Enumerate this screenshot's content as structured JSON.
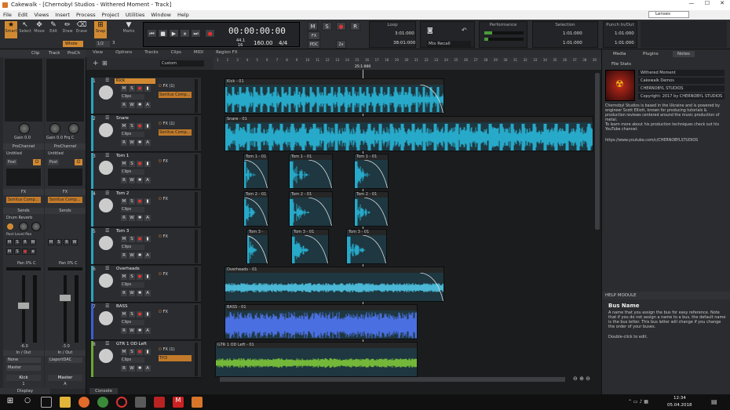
{
  "window": {
    "title": "Cakewalk - [Chernobyl Studios - Withered Moment - Track]",
    "app_icon": "cakewalk-icon"
  },
  "menu": [
    "File",
    "Edit",
    "Views",
    "Insert",
    "Process",
    "Project",
    "Utilities",
    "Window",
    "Help"
  ],
  "lenses": "Lenses",
  "tools": [
    {
      "label": "Smart",
      "icon": "star-icon"
    },
    {
      "label": "Select",
      "icon": "arrow-icon"
    },
    {
      "label": "Move",
      "icon": "move-icon"
    },
    {
      "label": "Edit",
      "icon": "pencil-edit-icon"
    },
    {
      "label": "Draw",
      "icon": "pencil-icon"
    },
    {
      "label": "Erase",
      "icon": "eraser-icon"
    }
  ],
  "snap": {
    "label": "Snap",
    "value": "1/2",
    "count": "3"
  },
  "marks": "Marks",
  "whole": "Whole",
  "transport": {
    "time": "00:00:00:00",
    "bars": "44.1",
    "bit": "16",
    "tempo": "160.00",
    "meter": "4/4"
  },
  "loop": {
    "label": "Loop",
    "start": "3:01:000",
    "end": "38:01:000"
  },
  "mix_recall": "Mix Recall",
  "performance": {
    "label": "Performance"
  },
  "selection": {
    "label": "Selection",
    "start": "1:01:000",
    "end": "1:01:000"
  },
  "punch": {
    "label": "Punch In/Out",
    "start": "1:01:000",
    "end": "1:01:000"
  },
  "mix_buttons": {
    "m": "M",
    "s": "S",
    "r": "R",
    "fx": "FX",
    "pdc": "PDC",
    "mode": "2x"
  },
  "inspector": {
    "tabs": [
      "Clip",
      "Track",
      "ProCh"
    ],
    "gain_label": "Gain",
    "gain_val": "0.0",
    "freq": "Frq",
    "freq_val": "C",
    "prochannel": "ProChannel",
    "untitled": "Untitled",
    "post": "Post",
    "fx": "FX",
    "fx_slot": "Sonitus Comp...",
    "sends": "Sends",
    "send_name": "Drum Reverb",
    "post2": "Post",
    "level": "Level",
    "pan": "Pan",
    "pan_label": "Pan",
    "pan_val": "0% C",
    "volume_left": "-6.0",
    "volume_right": "-3.0",
    "in_out": "In / Out",
    "input_left": "None",
    "input_right": "LlaportDAC",
    "output_left": "Master",
    "output_right": "",
    "name_left": "Kick",
    "name_right": "Master",
    "num_left": "1",
    "num_right": "A",
    "display": "Display"
  },
  "trackview": {
    "menu": [
      "View",
      "Options",
      "Tracks",
      "Clips",
      "MIDI",
      "Region FX"
    ],
    "preset": "Custom",
    "ruler": [
      "1",
      "2",
      "3",
      "4",
      "5",
      "6",
      "7",
      "8",
      "9",
      "10",
      "11",
      "12",
      "13",
      "14",
      "15",
      "16",
      "17",
      "18",
      "19",
      "20",
      "21",
      "22",
      "23",
      "24",
      "25",
      "26",
      "27",
      "28",
      "29",
      "30",
      "31",
      "32",
      "33",
      "34",
      "35",
      "36",
      "37",
      "38",
      "39"
    ],
    "playhead_label": "25:1:000"
  },
  "tracks": [
    {
      "num": "1",
      "name": "Kick",
      "selected": true,
      "fx": "FX (1)",
      "slot": "Sonitus Comp...",
      "clips": "Clips",
      "icon": "kick-drum-icon",
      "color": "#29a4c0"
    },
    {
      "num": "2",
      "name": "Snare",
      "selected": false,
      "fx": "FX (1)",
      "slot": "Sonitus Comp...",
      "clips": "Clips",
      "icon": "snare-drum-icon",
      "color": "#29a4c0"
    },
    {
      "num": "3",
      "name": "Tom 1",
      "selected": false,
      "fx": "FX",
      "slot": "",
      "clips": "Clips",
      "icon": "tom-drum-icon",
      "color": "#29a4c0"
    },
    {
      "num": "4",
      "name": "Tom 2",
      "selected": false,
      "fx": "FX",
      "slot": "",
      "clips": "Clips",
      "icon": "tom-drum-icon",
      "color": "#29a4c0"
    },
    {
      "num": "5",
      "name": "Tom 3",
      "selected": false,
      "fx": "FX",
      "slot": "",
      "clips": "Clips",
      "icon": "tom-drum-icon",
      "color": "#29a4c0"
    },
    {
      "num": "6",
      "name": "Overheads",
      "selected": false,
      "fx": "FX",
      "slot": "",
      "clips": "Clips",
      "icon": "cymbal-icon",
      "color": "#29a4c0"
    },
    {
      "num": "7",
      "name": "BASS",
      "selected": false,
      "fx": "FX",
      "slot": "",
      "clips": "Clips",
      "icon": "bass-guitar-icon",
      "color": "#3a5fd0"
    },
    {
      "num": "8",
      "name": "GTR 1 OD Left",
      "selected": false,
      "fx": "FX (1)",
      "slot": "TH3",
      "clips": "Clips",
      "icon": "guitar-icon",
      "color": "#6aa830"
    }
  ],
  "clips": [
    {
      "track": 0,
      "name": "Kick - 01"
    },
    {
      "track": 1,
      "name": "Snare - 01"
    },
    {
      "track": 2,
      "names": [
        "Tom 1 - 01",
        "Tom 1 - 01",
        "Tom 1 - 01"
      ]
    },
    {
      "track": 3,
      "names": [
        "Tom 2 - 01",
        "Tom 2 - 01",
        "Tom 2 - 01"
      ]
    },
    {
      "track": 4,
      "names": [
        "Tom 3 -",
        "Tom 3 - 01",
        "Tom 3 - 01"
      ]
    },
    {
      "track": 5,
      "name": "Overheads - 01"
    },
    {
      "track": 6,
      "name": "BASS - 01"
    },
    {
      "track": 7,
      "name": "GTR 1 OD Left - 01"
    }
  ],
  "browser": {
    "tabs": [
      "Media",
      "Plugins",
      "Notes"
    ],
    "file_stats": "File Stats",
    "project_name": "Withered Moment",
    "demos": "Cakewalk Demos",
    "studio": "CHERNOBYL STUDIOS",
    "copyright": "Copyright: 2017 by CHERNOBYL STUDIOS",
    "notes": "Chernobyl Studios is based in the Ukraine and is powered by engineer Scott Elliott, known for producing tutorials & production reviews centered around the music production of metal.",
    "notes2": "To learn more about his production techniques check out his YouTube channel:",
    "url": "https://www.youtube.com/c/CHERNOBYLSTUDIOS"
  },
  "help": {
    "header": "HELP MODULE",
    "title": "Bus Name",
    "body": "A name that you assign the bus for easy reference. Note that if you do not assign a name to a bus, the default name is the bus letter. This bus letter will change if you change the order of your buses.",
    "body2": "Double-click to edit."
  },
  "console_tab": "Console",
  "taskbar": {
    "time": "12:34",
    "date": "05.04.2018"
  }
}
